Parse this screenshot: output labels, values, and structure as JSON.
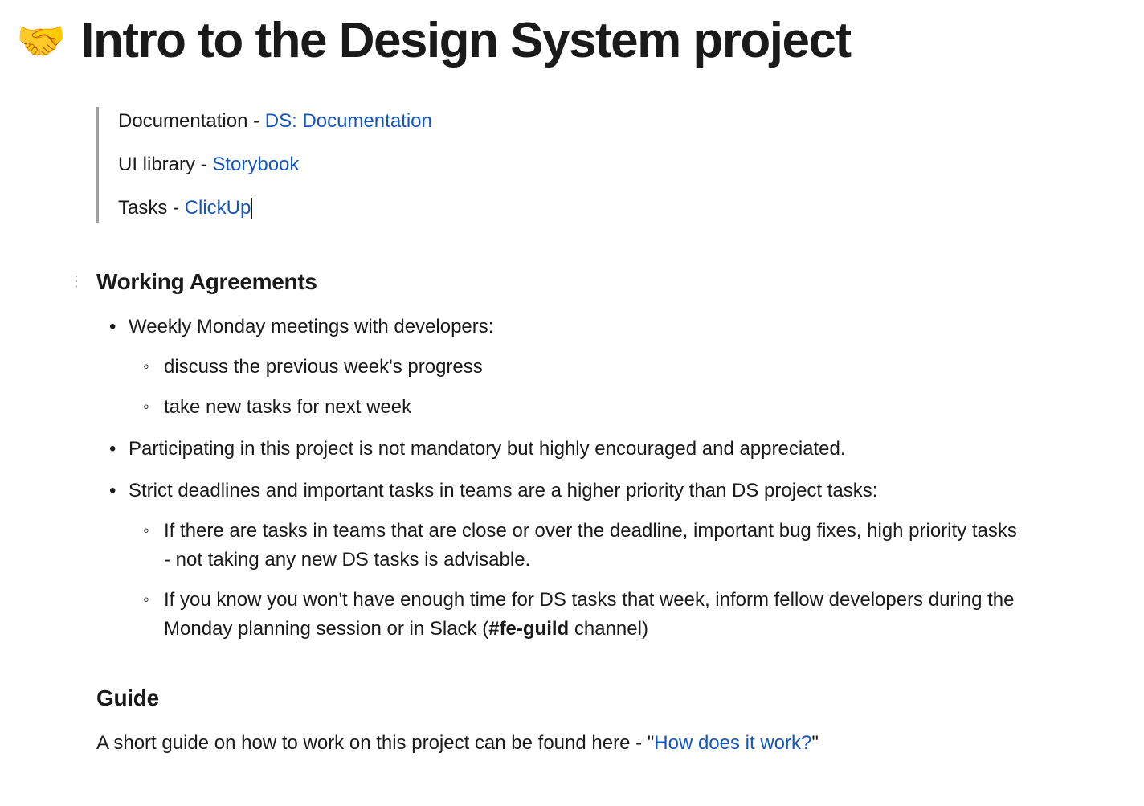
{
  "title_emoji": "🤝",
  "title": "Intro to the Design System project",
  "quote": {
    "doc_label": "Documentation - ",
    "doc_link": "DS: Documentation",
    "ui_label": "UI library - ",
    "ui_link": "Storybook",
    "tasks_label": "Tasks - ",
    "tasks_link": "ClickUp"
  },
  "working_agreements": {
    "heading": "Working Agreements",
    "item1": "Weekly Monday meetings with developers:",
    "item1_sub1": "discuss the previous week's progress",
    "item1_sub2": "take new tasks for next week",
    "item2": "Participating in this project is not mandatory but highly encouraged and appreciated.",
    "item3": "Strict deadlines and important tasks in teams are a higher priority than DS project tasks:",
    "item3_sub1": "If there are tasks in teams that are close or over the deadline, important bug fixes, high priority tasks - not taking any new DS tasks is advisable.",
    "item3_sub2_a": "If you know you won't have enough time for DS tasks that week, inform fellow developers during the Monday planning session or in Slack (",
    "item3_sub2_bold": "#fe-guild",
    "item3_sub2_b": " channel)"
  },
  "guide": {
    "heading": "Guide",
    "text_a": "A short guide on how to work on this project can be found here - \"",
    "link": "How does it work?",
    "text_b": "\""
  }
}
